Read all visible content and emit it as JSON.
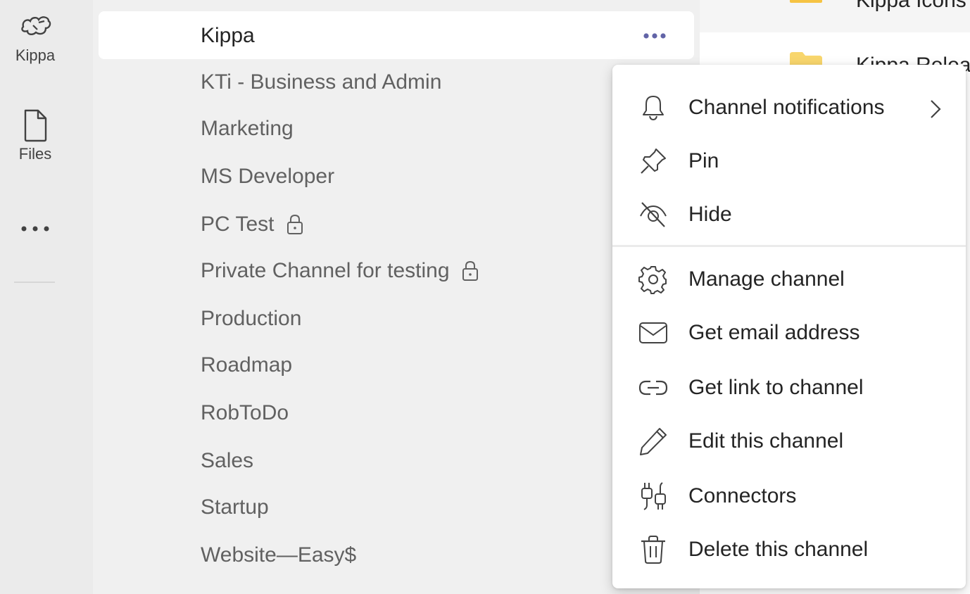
{
  "rail": {
    "items": [
      {
        "label": "Kippa",
        "icon": "team-logo-icon"
      },
      {
        "label": "Files",
        "icon": "file-icon"
      }
    ],
    "more_icon": "more-apps-icon"
  },
  "channels": {
    "selected": "Kippa",
    "items": [
      {
        "label": "KTi - Business and Admin",
        "private": false
      },
      {
        "label": "Marketing",
        "private": false
      },
      {
        "label": "MS Developer",
        "private": false
      },
      {
        "label": "PC Test",
        "private": true
      },
      {
        "label": "Private Channel for testing",
        "private": true
      },
      {
        "label": "Production",
        "private": false
      },
      {
        "label": "Roadmap",
        "private": false
      },
      {
        "label": "RobToDo",
        "private": false
      },
      {
        "label": "Sales",
        "private": false
      },
      {
        "label": "Startup",
        "private": false
      },
      {
        "label": "Website—Easy$",
        "private": false
      }
    ]
  },
  "content": {
    "files": [
      "Kippa Icons",
      "Kippa Relea"
    ]
  },
  "menu": {
    "items": [
      {
        "label": "Channel notifications",
        "icon": "bell-icon",
        "submenu": true
      },
      {
        "label": "Pin",
        "icon": "pin-icon"
      },
      {
        "label": "Hide",
        "icon": "eye-off-icon"
      },
      {
        "label": "Manage channel",
        "icon": "gear-icon"
      },
      {
        "label": "Get email address",
        "icon": "mail-icon"
      },
      {
        "label": "Get link to channel",
        "icon": "link-icon"
      },
      {
        "label": "Edit this channel",
        "icon": "pencil-icon"
      },
      {
        "label": "Connectors",
        "icon": "plug-icon"
      },
      {
        "label": "Delete this channel",
        "icon": "trash-icon"
      }
    ]
  },
  "colors": {
    "accent": "#6264a7",
    "icon": "#424242"
  }
}
